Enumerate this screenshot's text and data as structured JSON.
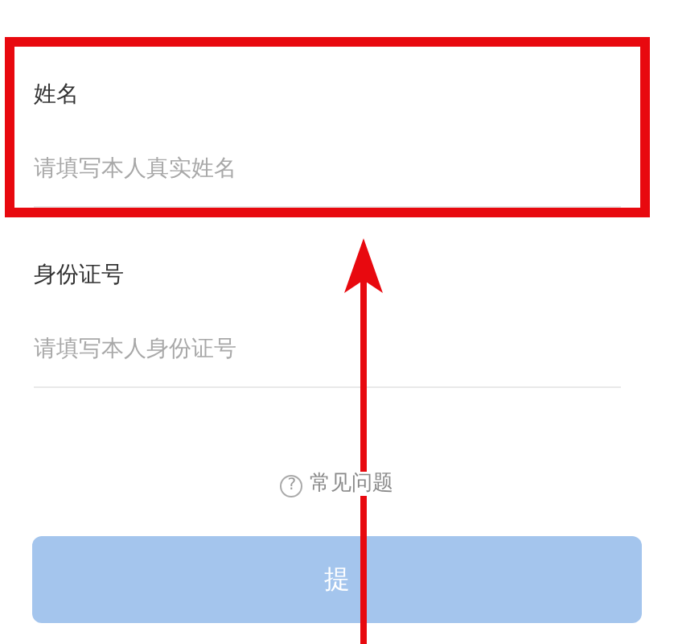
{
  "fields": [
    {
      "label": "姓名",
      "placeholder": "请填写本人真实姓名",
      "highlighted": true
    },
    {
      "label": "身份证号",
      "placeholder": "请填写本人身份证号",
      "highlighted": false
    }
  ],
  "help_link": {
    "icon": "?",
    "text": "常见问题"
  },
  "submit_button": {
    "label": "提",
    "disabled": true
  }
}
